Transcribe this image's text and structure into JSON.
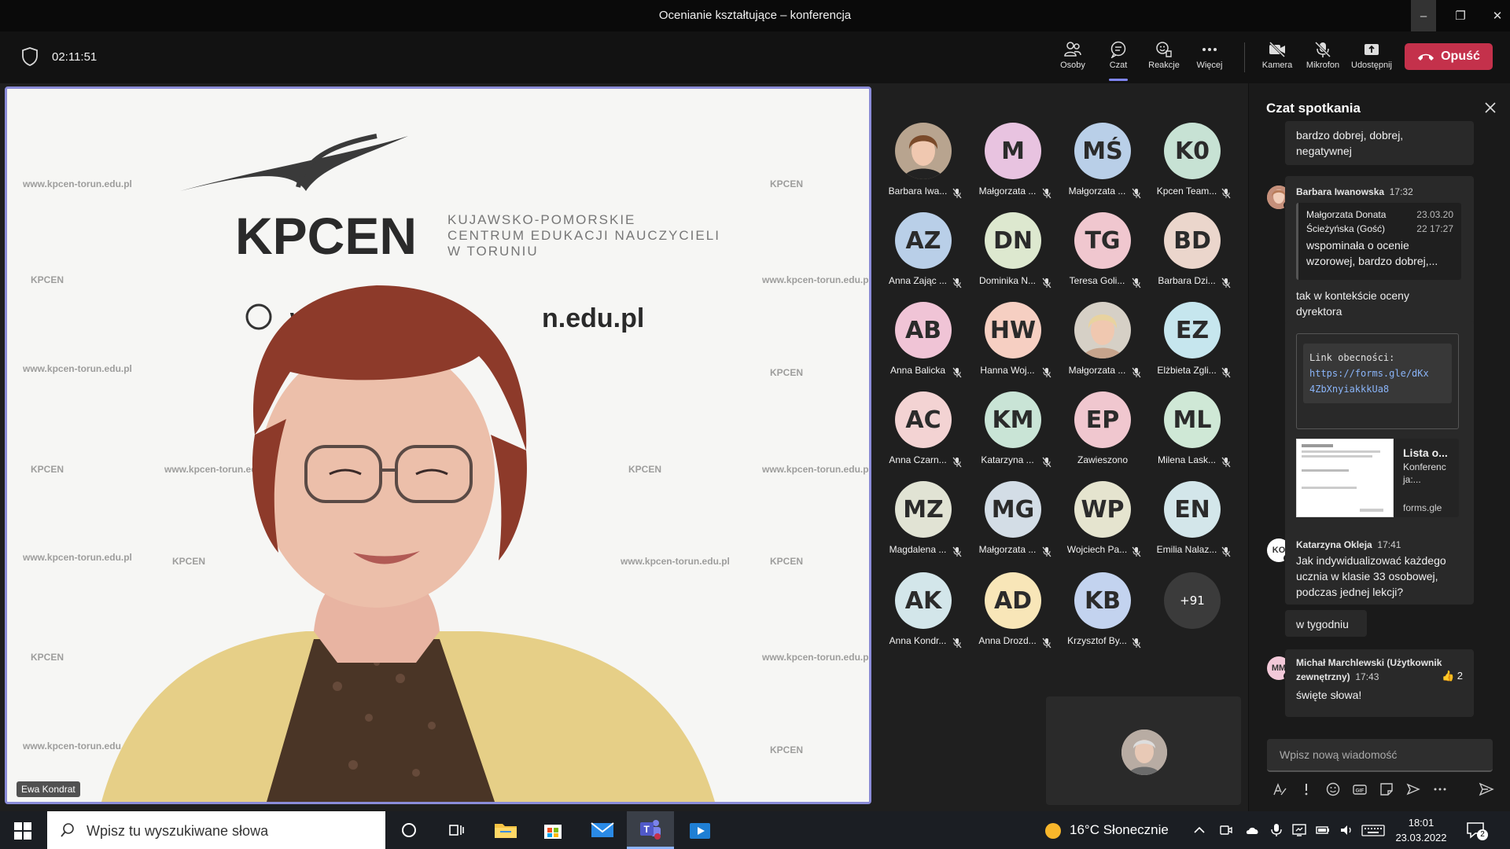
{
  "window": {
    "title": "Ocenianie kształtujące – konferencja",
    "minimize": "–",
    "maximize": "❐",
    "close": "✕"
  },
  "toolbar": {
    "timer": "02:11:51",
    "items": [
      {
        "label": "Osoby",
        "icon": "people-icon"
      },
      {
        "label": "Czat",
        "icon": "chat-icon"
      },
      {
        "label": "Reakcje",
        "icon": "reactions-icon"
      },
      {
        "label": "Więcej",
        "icon": "more-icon"
      },
      {
        "label": "Kamera",
        "icon": "camera-off-icon"
      },
      {
        "label": "Mikrofon",
        "icon": "mic-off-icon"
      },
      {
        "label": "Udostępnij",
        "icon": "share-icon"
      }
    ],
    "leave_label": "Opuść",
    "leave_color": "#c4314b",
    "active_color": "#7f85f5"
  },
  "video": {
    "speaker_name": "Ewa Kondrat",
    "banner_logo": "KPCEN",
    "banner_subtitle": [
      "KUJAWSKO-POMORSKIE",
      "CENTRUM EDUKACJI NAUCZYCIELI",
      "W TORUNIU"
    ],
    "banner_url": "www.kpcen-torun.edu.pl",
    "banner_url_visible": "w",
    "banner_url_tail": "n.edu.pl"
  },
  "participants": [
    {
      "initials": "",
      "name": "Barbara Iwa...",
      "color": "photo",
      "muted": true
    },
    {
      "initials": "M",
      "name": "Małgorzata ...",
      "color": "#e8c3e0",
      "muted": true
    },
    {
      "initials": "MŚ",
      "name": "Małgorzata ...",
      "color": "#b9cfe8",
      "muted": true
    },
    {
      "initials": "K0",
      "name": "Kpcen Team...",
      "color": "#c7e2d4",
      "muted": true
    },
    {
      "initials": "AZ",
      "name": "Anna Zając ...",
      "color": "#b9cfe8",
      "muted": true
    },
    {
      "initials": "DN",
      "name": "Dominika N...",
      "color": "#dde8cf",
      "muted": true
    },
    {
      "initials": "TG",
      "name": "Teresa Goli...",
      "color": "#f0c7cf",
      "muted": true
    },
    {
      "initials": "BD",
      "name": "Barbara Dzi...",
      "color": "#ebd6cc",
      "muted": true
    },
    {
      "initials": "AB",
      "name": "Anna Balicka",
      "color": "#f0c4d6",
      "muted": true
    },
    {
      "initials": "HW",
      "name": "Hanna Woj...",
      "color": "#f6cfc2",
      "muted": true
    },
    {
      "initials": "",
      "name": "Małgorzata ...",
      "color": "photo2",
      "muted": true
    },
    {
      "initials": "EZ",
      "name": "Elżbieta Zgli...",
      "color": "#c6e6ee",
      "muted": true
    },
    {
      "initials": "AC",
      "name": "Anna Czarn...",
      "color": "#f3d3d3",
      "muted": true
    },
    {
      "initials": "KM",
      "name": "Katarzyna ...",
      "color": "#c9e4d6",
      "muted": true
    },
    {
      "initials": "EP",
      "name": "Zawieszono",
      "color": "#f0c7cf",
      "muted": false
    },
    {
      "initials": "ML",
      "name": "Milena Lask...",
      "color": "#cfe8d6",
      "muted": true
    },
    {
      "initials": "MZ",
      "name": "Magdalena ...",
      "color": "#e1e3d4",
      "muted": true
    },
    {
      "initials": "MG",
      "name": "Małgorzata ...",
      "color": "#d3dde6",
      "muted": true
    },
    {
      "initials": "WP",
      "name": "Wojciech Pa...",
      "color": "#e5e4cf",
      "muted": true
    },
    {
      "initials": "EN",
      "name": "Emilia Nalaz...",
      "color": "#d3e6ea",
      "muted": true
    },
    {
      "initials": "AK",
      "name": "Anna Kondr...",
      "color": "#d3e6ea",
      "muted": true
    },
    {
      "initials": "AD",
      "name": "Anna Drozd...",
      "color": "#f8e6b8",
      "muted": true
    },
    {
      "initials": "KB",
      "name": "Krzysztof By...",
      "color": "#c3d3ef",
      "muted": true
    },
    {
      "initials": "+91",
      "name": "",
      "color": "#3b3b3b",
      "muted": false
    }
  ],
  "chat": {
    "title": "Czat spotkania",
    "top_fragment": [
      "bardzo dobrej, dobrej,",
      "negatywnej"
    ],
    "msg1": {
      "sender": "Barbara Iwanowska",
      "time": "17:32",
      "quote_author": [
        "Małgorzata Donata",
        "Ścieżyńska (Gość)"
      ],
      "quote_time": [
        "23.03.20",
        "22 17:27"
      ],
      "quote_text": [
        "wspominała o ocenie",
        "wzorowej, bardzo dobrej,..."
      ],
      "text": [
        "tak w kontekście oceny",
        "dyrektora"
      ],
      "code_label": "Link obecności:",
      "code_link": [
        "https://forms.gle/dKx",
        "4ZbXnyiakkkUa8"
      ],
      "card_title": "Lista o...",
      "card_desc": [
        "Konferenc",
        "ja:..."
      ],
      "card_domain": "forms.gle"
    },
    "msg2": {
      "initials": "KO",
      "sender": "Katarzyna Okleja",
      "time": "17:41",
      "text": [
        "Jak indywidualizować każdego",
        "ucznia w klasie 33 osobowej,",
        "podczas jednej lekcji?"
      ],
      "followup": "w tygodniu"
    },
    "msg3": {
      "initials": "MM",
      "sender": [
        "Michał Marchlewski (Użytkownik",
        "zewnętrzny)"
      ],
      "time": "17:43",
      "reaction": "👍",
      "reaction_count": "2",
      "text": "święte słowa!"
    },
    "compose_placeholder": "Wpisz nową wiadomość"
  },
  "taskbar": {
    "search_placeholder": "Wpisz tu wyszukiwane słowa",
    "weather": "16°C  Słonecznie",
    "time": "18:01",
    "date": "23.03.2022",
    "notifications": "2"
  }
}
